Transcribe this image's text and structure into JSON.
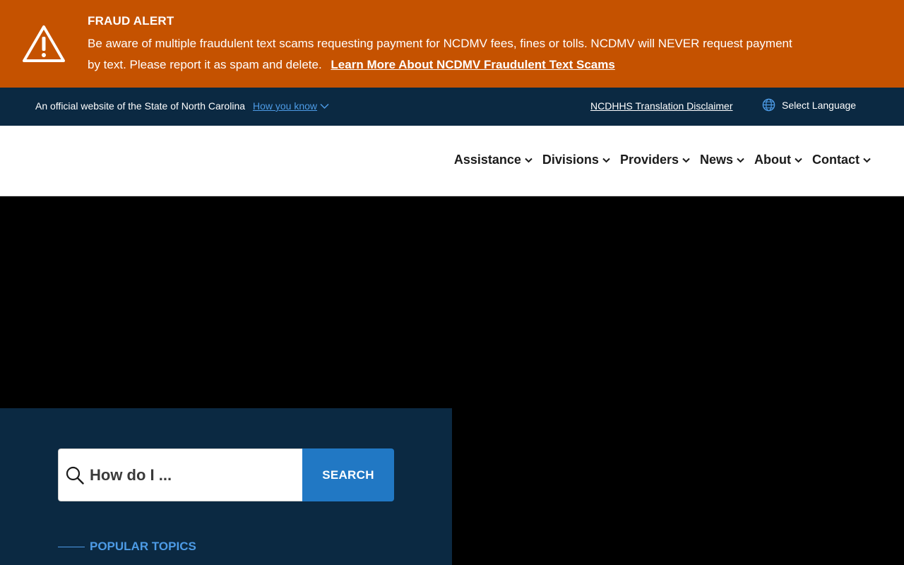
{
  "alert": {
    "title": "FRAUD ALERT",
    "message": "Be aware of multiple fraudulent text scams requesting payment for NCDMV fees, fines or tolls. NCDMV will NEVER request payment by text. Please report it as spam and delete.",
    "link_label": "Learn More About NCDMV Fraudulent Text Scams",
    "icon": "warning-triangle-icon",
    "color": "#c55200"
  },
  "official_bar": {
    "text": "An official website of the State of North Carolina",
    "how_you_know": "How you know",
    "disclaimer": "NCDHHS Translation Disclaimer",
    "language": "Select Language",
    "color": "#0b2942",
    "link_color": "#4d9be6"
  },
  "nav": {
    "items": [
      {
        "label": "Assistance"
      },
      {
        "label": "Divisions"
      },
      {
        "label": "Providers"
      },
      {
        "label": "News"
      },
      {
        "label": "About"
      },
      {
        "label": "Contact"
      }
    ]
  },
  "search": {
    "placeholder": "How do I ...",
    "button_label": "SEARCH",
    "button_color": "#2178c4"
  },
  "popular_topics": {
    "heading": "POPULAR TOPICS"
  }
}
